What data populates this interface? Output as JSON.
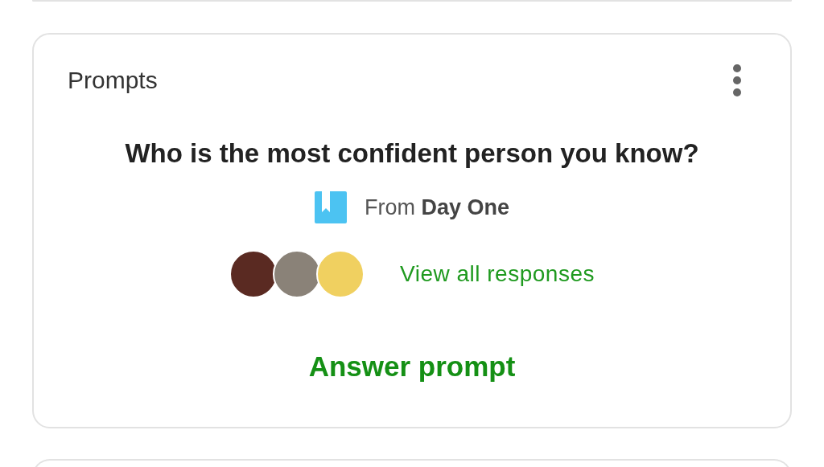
{
  "card": {
    "title": "Prompts",
    "question": "Who is the most confident person you know?",
    "source": "From **Day One**",
    "responses_link": "View all responses",
    "answer_button": "Answer prompt"
  }
}
